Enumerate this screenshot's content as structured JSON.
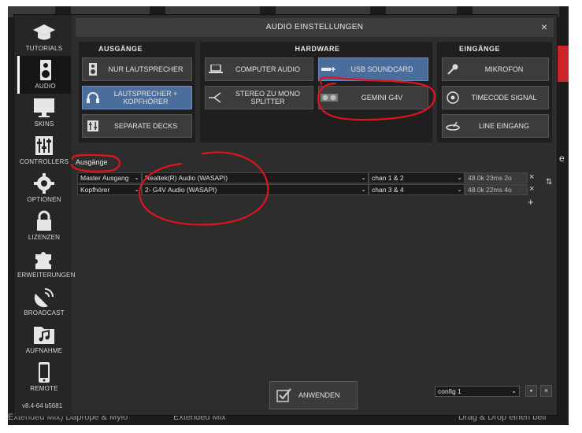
{
  "background": {
    "bottom_left_text": "Extended Mix) Daprope & Mylo",
    "bottom_mid_text": "Extended Mix",
    "bottom_right_text": "Drag & Drop einen beli",
    "right_letter": "e"
  },
  "dialog": {
    "title": "AUDIO EINSTELLUNGEN",
    "close_label": "×"
  },
  "sidebar": {
    "items": [
      {
        "label": "TUTORIALS",
        "icon": "graduation-cap-icon"
      },
      {
        "label": "AUDIO",
        "icon": "speaker-icon",
        "active": true
      },
      {
        "label": "SKINS",
        "icon": "monitor-icon"
      },
      {
        "label": "CONTROLLERS",
        "icon": "sliders-icon"
      },
      {
        "label": "OPTIONEN",
        "icon": "gear-icon"
      },
      {
        "label": "LIZENZEN",
        "icon": "lock-icon"
      },
      {
        "label": "ERWEITERUNGEN",
        "icon": "puzzle-icon"
      },
      {
        "label": "BROADCAST",
        "icon": "satellite-dish-icon"
      },
      {
        "label": "AUFNAHME",
        "icon": "music-folder-icon"
      },
      {
        "label": "REMOTE",
        "icon": "phone-icon"
      }
    ],
    "version": "v8.4-64 b5681"
  },
  "groups": {
    "outputs": {
      "title": "AUSGÄNGE",
      "buttons": [
        {
          "label": "NUR LAUTSPRECHER",
          "icon": "speaker-icon",
          "selected": false
        },
        {
          "label": "LAUTSPRECHER + KOPFHÖRER",
          "icon": "headphones-icon",
          "selected": true
        },
        {
          "label": "SEPARATE DECKS",
          "icon": "mixer-icon",
          "selected": false
        }
      ]
    },
    "hardware": {
      "title": "HARDWARE",
      "buttons": [
        {
          "label": "COMPUTER AUDIO",
          "icon": "laptop-icon",
          "selected": false
        },
        {
          "label": "USB SOUNDCARD",
          "icon": "usb-icon",
          "selected": true
        },
        {
          "label": "STEREO ZU MONO SPLITTER",
          "icon": "splitter-icon",
          "selected": false
        },
        {
          "label": "GEMINI G4V",
          "icon": "controller-icon",
          "selected": false
        }
      ]
    },
    "inputs": {
      "title": "EINGÄNGE",
      "buttons": [
        {
          "label": "MIKROFON",
          "icon": "microphone-icon",
          "selected": false
        },
        {
          "label": "TIMECODE SIGNAL",
          "icon": "vinyl-icon",
          "selected": false
        },
        {
          "label": "LINE EINGANG",
          "icon": "turntable-icon",
          "selected": false
        }
      ]
    }
  },
  "outputs_table": {
    "section_label": "Ausgänge",
    "rows": [
      {
        "output": "Master Ausgang",
        "device": "Realtek(R) Audio (WASAPI)",
        "channels": "chan 1 & 2",
        "info": "48.0k 23ms 2o"
      },
      {
        "output": "Kopfhörer",
        "device": "2- G4V Audio (WASAPI)",
        "channels": "chan 3 & 4",
        "info": "48.0k 22ms 4o"
      }
    ],
    "remove_label": "×",
    "add_label": "+",
    "swap_label": "⇅"
  },
  "footer": {
    "apply_label": "ANWENDEN",
    "config_value": "config 1",
    "save_label": "▪",
    "delete_label": "×"
  },
  "colors": {
    "selected": "#4a6d9c",
    "annotation": "#e0141e"
  }
}
